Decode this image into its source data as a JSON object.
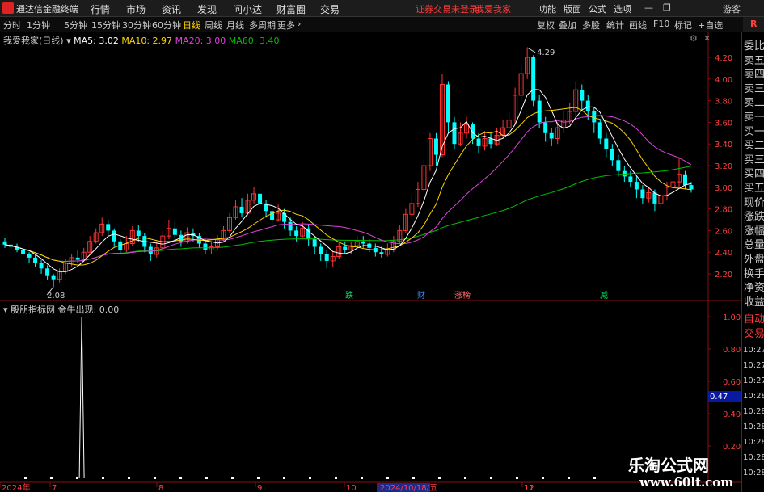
{
  "app": {
    "title": "通达信金融终端"
  },
  "menu": [
    "行情",
    "市场",
    "资讯",
    "发现",
    "问小达",
    "财富圈",
    "交易"
  ],
  "login_status": "证券交易未登录",
  "login_user": "我爱我家",
  "right_menu": [
    "功能",
    "版面",
    "公式",
    "选项"
  ],
  "guest": "游客",
  "timeframes": [
    "分时",
    "1分钟",
    "5分钟",
    "15分钟",
    "30分钟",
    "60分钟",
    "日线",
    "周线",
    "月线",
    "多周期",
    "更多"
  ],
  "active_timeframe": "日线",
  "toolbar_right": [
    "复权",
    "叠加",
    "多股",
    "统计",
    "画线",
    "F10",
    "标记",
    "+自选"
  ],
  "right_tab": "R",
  "stock": {
    "name_period": "我爱我家(日线)",
    "ma5": "MA5: 3.02",
    "ma10": "MA10: 2.97",
    "ma20": "MA20: 3.00",
    "ma60": "MA60: 3.40"
  },
  "colors": {
    "ma5": "#ffffff",
    "ma10": "#ffd400",
    "ma20": "#e040e0",
    "ma60": "#00c000",
    "up": "#ff3333",
    "down": "#00ffff"
  },
  "price_axis": {
    "ticks": [
      "4.20",
      "4.00",
      "3.80",
      "3.60",
      "3.40",
      "3.20",
      "3.00",
      "2.80",
      "2.60",
      "2.40",
      "2.20"
    ],
    "max_label": "4.29",
    "min_label": "2.08"
  },
  "markers": [
    {
      "text": "跌",
      "color": "#00e060"
    },
    {
      "text": "财",
      "color": "#3a8cff"
    },
    {
      "text": "涨榜",
      "color": "#ff6a6a"
    },
    {
      "text": "减",
      "color": "#00e060"
    }
  ],
  "indicator": {
    "name": "殷朋指标网",
    "line": "金牛出现: 0.00",
    "ticks": [
      "1.00",
      "0.80",
      "0.60",
      "0.40",
      "0.20"
    ],
    "current": "0.47"
  },
  "dates": [
    "2024年",
    "7",
    "8",
    "9",
    "10",
    "2024/10/18/五",
    "11",
    "12"
  ],
  "sidebar_items": [
    "委比",
    "卖五",
    "卖四",
    "卖三",
    "卖二",
    "卖一",
    "买一",
    "买二",
    "买三",
    "买四",
    "买五",
    "现价",
    "涨跌",
    "涨幅",
    "总量",
    "外盘",
    "换手",
    "净资",
    "收益",
    "自动",
    "交易"
  ],
  "sidebar_times": [
    "10:27",
    "10:27",
    "10:27",
    "10:28",
    "10:28",
    "10:28",
    "10:28",
    "10:28",
    "10:28"
  ],
  "watermark": {
    "line1": "乐淘公式网",
    "line2": "www.60lt.com"
  },
  "chart_data": {
    "type": "candlestick",
    "y_range": [
      2.08,
      4.29
    ],
    "candles": [
      [
        2.5,
        2.47,
        2.53,
        2.44
      ],
      [
        2.47,
        2.45,
        2.5,
        2.42
      ],
      [
        2.45,
        2.42,
        2.48,
        2.4
      ],
      [
        2.42,
        2.38,
        2.45,
        2.35
      ],
      [
        2.38,
        2.35,
        2.4,
        2.3
      ],
      [
        2.35,
        2.3,
        2.38,
        2.26
      ],
      [
        2.3,
        2.25,
        2.33,
        2.2
      ],
      [
        2.25,
        2.18,
        2.28,
        2.14
      ],
      [
        2.18,
        2.15,
        2.2,
        2.08
      ],
      [
        2.15,
        2.22,
        2.25,
        2.12
      ],
      [
        2.22,
        2.3,
        2.34,
        2.2
      ],
      [
        2.3,
        2.35,
        2.38,
        2.27
      ],
      [
        2.35,
        2.33,
        2.42,
        2.3
      ],
      [
        2.33,
        2.4,
        2.44,
        2.31
      ],
      [
        2.4,
        2.5,
        2.55,
        2.38
      ],
      [
        2.5,
        2.58,
        2.62,
        2.48
      ],
      [
        2.58,
        2.66,
        2.72,
        2.55
      ],
      [
        2.66,
        2.6,
        2.7,
        2.55
      ],
      [
        2.6,
        2.5,
        2.62,
        2.45
      ],
      [
        2.5,
        2.42,
        2.52,
        2.38
      ],
      [
        2.42,
        2.48,
        2.55,
        2.4
      ],
      [
        2.48,
        2.6,
        2.64,
        2.46
      ],
      [
        2.6,
        2.55,
        2.65,
        2.5
      ],
      [
        2.55,
        2.45,
        2.58,
        2.4
      ],
      [
        2.45,
        2.38,
        2.48,
        2.32
      ],
      [
        2.38,
        2.44,
        2.5,
        2.35
      ],
      [
        2.44,
        2.55,
        2.6,
        2.42
      ],
      [
        2.55,
        2.62,
        2.7,
        2.52
      ],
      [
        2.62,
        2.56,
        2.68,
        2.5
      ],
      [
        2.56,
        2.5,
        2.6,
        2.45
      ],
      [
        2.5,
        2.58,
        2.63,
        2.48
      ],
      [
        2.58,
        2.55,
        2.62,
        2.5
      ],
      [
        2.55,
        2.48,
        2.58,
        2.44
      ],
      [
        2.48,
        2.42,
        2.52,
        2.38
      ],
      [
        2.42,
        2.45,
        2.5,
        2.38
      ],
      [
        2.45,
        2.52,
        2.56,
        2.42
      ],
      [
        2.52,
        2.6,
        2.64,
        2.5
      ],
      [
        2.6,
        2.72,
        2.76,
        2.58
      ],
      [
        2.72,
        2.82,
        2.88,
        2.7
      ],
      [
        2.82,
        2.76,
        2.9,
        2.72
      ],
      [
        2.76,
        2.88,
        2.94,
        2.74
      ],
      [
        2.88,
        2.94,
        3.0,
        2.85
      ],
      [
        2.94,
        2.85,
        2.98,
        2.8
      ],
      [
        2.85,
        2.78,
        2.88,
        2.72
      ],
      [
        2.78,
        2.7,
        2.8,
        2.65
      ],
      [
        2.7,
        2.76,
        2.84,
        2.68
      ],
      [
        2.76,
        2.68,
        2.8,
        2.62
      ],
      [
        2.68,
        2.6,
        2.72,
        2.55
      ],
      [
        2.6,
        2.55,
        2.64,
        2.5
      ],
      [
        2.55,
        2.62,
        2.68,
        2.52
      ],
      [
        2.62,
        2.52,
        2.66,
        2.46
      ],
      [
        2.52,
        2.45,
        2.55,
        2.38
      ],
      [
        2.45,
        2.38,
        2.48,
        2.32
      ],
      [
        2.38,
        2.32,
        2.42,
        2.25
      ],
      [
        2.32,
        2.36,
        2.4,
        2.26
      ],
      [
        2.36,
        2.45,
        2.5,
        2.34
      ],
      [
        2.45,
        2.42,
        2.5,
        2.38
      ],
      [
        2.42,
        2.46,
        2.5,
        2.38
      ],
      [
        2.46,
        2.5,
        2.55,
        2.44
      ],
      [
        2.5,
        2.48,
        2.55,
        2.44
      ],
      [
        2.48,
        2.44,
        2.52,
        2.4
      ],
      [
        2.44,
        2.4,
        2.48,
        2.36
      ],
      [
        2.4,
        2.38,
        2.45,
        2.35
      ],
      [
        2.38,
        2.42,
        2.48,
        2.36
      ],
      [
        2.42,
        2.5,
        2.55,
        2.4
      ],
      [
        2.5,
        2.6,
        2.65,
        2.48
      ],
      [
        2.6,
        2.75,
        2.8,
        2.58
      ],
      [
        2.75,
        2.85,
        2.92,
        2.72
      ],
      [
        2.85,
        2.98,
        3.05,
        2.82
      ],
      [
        2.98,
        3.2,
        3.25,
        2.95
      ],
      [
        3.2,
        3.45,
        3.5,
        3.15
      ],
      [
        3.45,
        3.3,
        3.5,
        3.2
      ],
      [
        3.3,
        3.95,
        4.05,
        3.28
      ],
      [
        3.95,
        3.6,
        3.98,
        3.5
      ],
      [
        3.6,
        3.4,
        3.65,
        3.35
      ],
      [
        3.4,
        3.5,
        3.6,
        3.38
      ],
      [
        3.5,
        3.58,
        3.65,
        3.45
      ],
      [
        3.58,
        3.45,
        3.6,
        3.4
      ],
      [
        3.45,
        3.38,
        3.5,
        3.32
      ],
      [
        3.38,
        3.45,
        3.52,
        3.34
      ],
      [
        3.45,
        3.4,
        3.5,
        3.36
      ],
      [
        3.4,
        3.48,
        3.55,
        3.38
      ],
      [
        3.48,
        3.55,
        3.62,
        3.45
      ],
      [
        3.55,
        3.62,
        3.7,
        3.5
      ],
      [
        3.62,
        3.85,
        3.92,
        3.58
      ],
      [
        3.85,
        4.05,
        4.12,
        3.8
      ],
      [
        4.05,
        4.2,
        4.29,
        4.0
      ],
      [
        4.2,
        3.8,
        4.22,
        3.75
      ],
      [
        3.8,
        3.6,
        3.85,
        3.55
      ],
      [
        3.6,
        3.5,
        3.65,
        3.42
      ],
      [
        3.5,
        3.45,
        3.55,
        3.38
      ],
      [
        3.45,
        3.55,
        3.6,
        3.4
      ],
      [
        3.55,
        3.62,
        3.7,
        3.5
      ],
      [
        3.62,
        3.7,
        3.78,
        3.58
      ],
      [
        3.7,
        3.9,
        3.98,
        3.65
      ],
      [
        3.9,
        3.8,
        3.95,
        3.72
      ],
      [
        3.8,
        3.7,
        3.85,
        3.62
      ],
      [
        3.7,
        3.6,
        3.74,
        3.5
      ],
      [
        3.6,
        3.45,
        3.62,
        3.4
      ],
      [
        3.45,
        3.35,
        3.5,
        3.28
      ],
      [
        3.35,
        3.25,
        3.4,
        3.2
      ],
      [
        3.25,
        3.15,
        3.3,
        3.1
      ],
      [
        3.15,
        3.1,
        3.2,
        3.05
      ],
      [
        3.1,
        3.05,
        3.15,
        3.0
      ],
      [
        3.05,
        2.98,
        3.1,
        2.9
      ],
      [
        2.98,
        2.9,
        3.02,
        2.85
      ],
      [
        2.9,
        2.95,
        3.0,
        2.86
      ],
      [
        2.95,
        2.85,
        2.98,
        2.78
      ],
      [
        2.85,
        2.92,
        2.98,
        2.8
      ],
      [
        2.92,
        3.0,
        3.05,
        2.88
      ],
      [
        3.0,
        3.05,
        3.1,
        2.95
      ],
      [
        3.05,
        3.12,
        3.28,
        3.0
      ],
      [
        3.12,
        3.02,
        3.15,
        2.98
      ],
      [
        3.02,
        2.98,
        3.05,
        2.95
      ]
    ],
    "indicator_spike_index": 8
  }
}
